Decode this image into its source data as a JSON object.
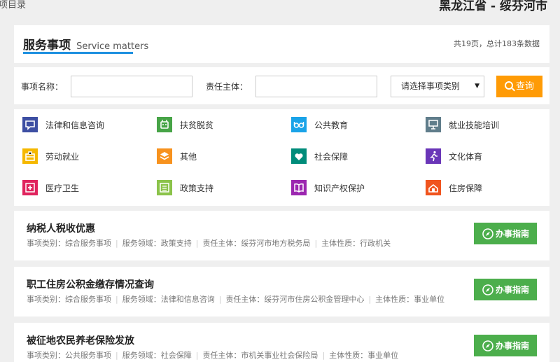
{
  "topbar": {
    "left_text": "项目录",
    "location": "黑龙江省 - 绥芬河市"
  },
  "header": {
    "title_cn": "服务事项",
    "title_en": "Service matters",
    "stats": "共19页，总计183条数据",
    "accent_color": "#1e90e0"
  },
  "search": {
    "name_label": "事项名称：",
    "name_value": "",
    "owner_label": "责任主体：",
    "owner_value": "",
    "category_select": "请选择事项类别",
    "query_button": "查询",
    "query_color": "#ff9b06"
  },
  "categories": [
    {
      "label": "法律和信息咨询",
      "icon": "chat-bubble-icon",
      "color": "#3d4fa3"
    },
    {
      "label": "扶贫脱贫",
      "icon": "robot-icon",
      "color": "#47a447"
    },
    {
      "label": "公共教育",
      "icon": "glasses-icon",
      "color": "#1aa3e8"
    },
    {
      "label": "就业技能培训",
      "icon": "presentation-icon",
      "color": "#607d8b"
    },
    {
      "label": "劳动就业",
      "icon": "briefcase-icon",
      "color": "#f5b800"
    },
    {
      "label": "其他",
      "icon": "layers-icon",
      "color": "#f7921e"
    },
    {
      "label": "社会保障",
      "icon": "heart-icon",
      "color": "#008c7a"
    },
    {
      "label": "文化体育",
      "icon": "runner-icon",
      "color": "#6a36b8"
    },
    {
      "label": "医疗卫生",
      "icon": "medical-cross-icon",
      "color": "#e0245e"
    },
    {
      "label": "政策支持",
      "icon": "document-icon",
      "color": "#8bc34a"
    },
    {
      "label": "知识产权保护",
      "icon": "book-icon",
      "color": "#9c27b0"
    },
    {
      "label": "住房保障",
      "icon": "house-icon",
      "color": "#f0541e"
    }
  ],
  "items": [
    {
      "title": "纳税人税收优惠",
      "meta": [
        "事项类别：综合服务事项",
        "服务领域：政策支持",
        "责任主体：绥芬河市地方税务局",
        "主体性质：行政机关"
      ],
      "guide_label": "办事指南"
    },
    {
      "title": "职工住房公积金缴存情况查询",
      "meta": [
        "事项类别：综合服务事项",
        "服务领域：法律和信息咨询",
        "责任主体：绥芬河市住房公积金管理中心",
        "主体性质：事业单位"
      ],
      "guide_label": "办事指南"
    },
    {
      "title": "被征地农民养老保险发放",
      "meta": [
        "事项类别：公共服务事项",
        "服务领域：社会保障",
        "责任主体：市机关事业社会保险局",
        "主体性质：事业单位"
      ],
      "guide_label": "办事指南"
    }
  ],
  "guide_color": "#4cae4c"
}
